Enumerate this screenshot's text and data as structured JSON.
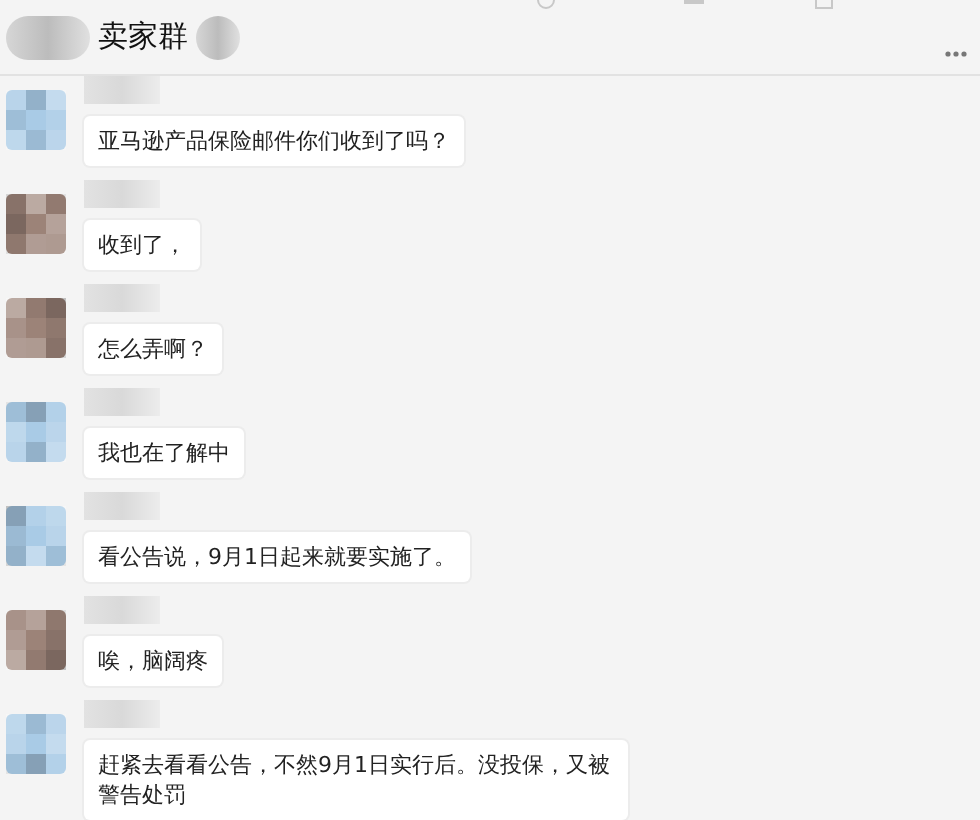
{
  "chat": {
    "title": "卖家群"
  },
  "messages": [
    {
      "color": "#a9cbe6",
      "text": "亚马逊产品保险邮件你们收到了吗？"
    },
    {
      "color": "#9c8378",
      "text": "收到了，"
    },
    {
      "color": "#9c8378",
      "text": "怎么弄啊？"
    },
    {
      "color": "#a9cbe6",
      "text": "我也在了解中"
    },
    {
      "color": "#a9cbe6",
      "text": "看公告说，9月1日起来就要实施了。"
    },
    {
      "color": "#9c8378",
      "text": "唉，脑阔疼"
    },
    {
      "color": "#a9cbe6",
      "text": "赶紧去看看公告，不然9月1日实行后。没投保，又被警告处罚"
    }
  ]
}
